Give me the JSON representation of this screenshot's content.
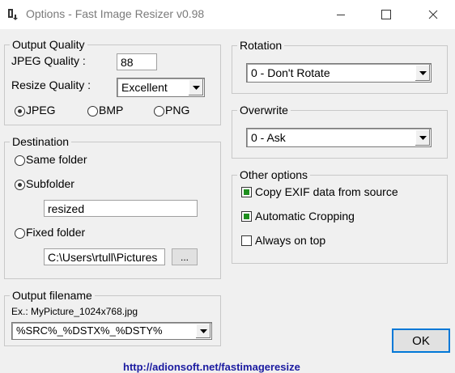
{
  "window": {
    "title": "Options - Fast Image Resizer v0.98",
    "controls": [
      "minimize-icon",
      "maximize-icon",
      "close-icon"
    ]
  },
  "output_quality": {
    "legend": "Output Quality",
    "jpeg_quality_label": "JPEG Quality :",
    "jpeg_quality_value": "88",
    "resize_quality_label": "Resize Quality :",
    "resize_quality_value": "Excellent",
    "formats": [
      {
        "label": "JPEG",
        "selected": true
      },
      {
        "label": "BMP",
        "selected": false
      },
      {
        "label": "PNG",
        "selected": false
      }
    ]
  },
  "destination": {
    "legend": "Destination",
    "same_folder_label": "Same folder",
    "same_folder_selected": false,
    "subfolder_label": "Subfolder",
    "subfolder_selected": true,
    "subfolder_value": "resized",
    "fixed_folder_label": "Fixed folder",
    "fixed_folder_selected": false,
    "fixed_folder_value": "C:\\Users\\rtull\\Pictures",
    "browse_label": "..."
  },
  "output_filename": {
    "legend": "Output filename",
    "example": "Ex.: MyPicture_1024x768.jpg",
    "pattern": "%SRC%_%DSTX%_%DSTY%"
  },
  "rotation": {
    "legend": "Rotation",
    "value": "0 - Don't Rotate"
  },
  "overwrite": {
    "legend": "Overwrite",
    "value": "0 - Ask"
  },
  "other_options": {
    "legend": "Other options",
    "copy_exif_label": "Copy EXIF data from source",
    "copy_exif_checked": true,
    "auto_crop_label": "Automatic Cropping",
    "auto_crop_checked": true,
    "always_on_top_label": "Always on top",
    "always_on_top_checked": false
  },
  "ok_label": "OK",
  "footer_link": "http://adionsoft.net/fastimageresize",
  "colors": {
    "check_fill": "#1f8f1f",
    "link": "#1a1aa0",
    "window_bg": "#f0f0f0"
  }
}
